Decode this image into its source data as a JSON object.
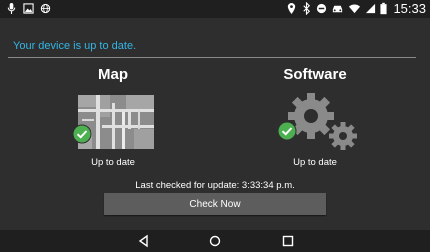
{
  "status_bar": {
    "time": "15:33",
    "left_icons": [
      "mic-icon",
      "image-icon",
      "globe-icon"
    ],
    "right_icons": [
      "location-icon",
      "bluetooth-icon",
      "minus-circle-icon",
      "car-icon",
      "wifi-icon",
      "signal-icon",
      "battery-icon"
    ]
  },
  "header": {
    "message": "Your device is up to date."
  },
  "map": {
    "title": "Map",
    "status": "Up to date"
  },
  "software": {
    "title": "Software",
    "status": "Up to date"
  },
  "footer": {
    "last_checked": "Last checked for update: 3:33:34 p.m.",
    "check_button": "Check Now"
  },
  "nav_bar": {
    "buttons": [
      "back-icon",
      "home-icon",
      "recents-icon"
    ]
  },
  "colors": {
    "accent": "#33b5e5",
    "success": "#4caf50",
    "background": "#2e2e2e",
    "button": "#5d5d5d"
  }
}
